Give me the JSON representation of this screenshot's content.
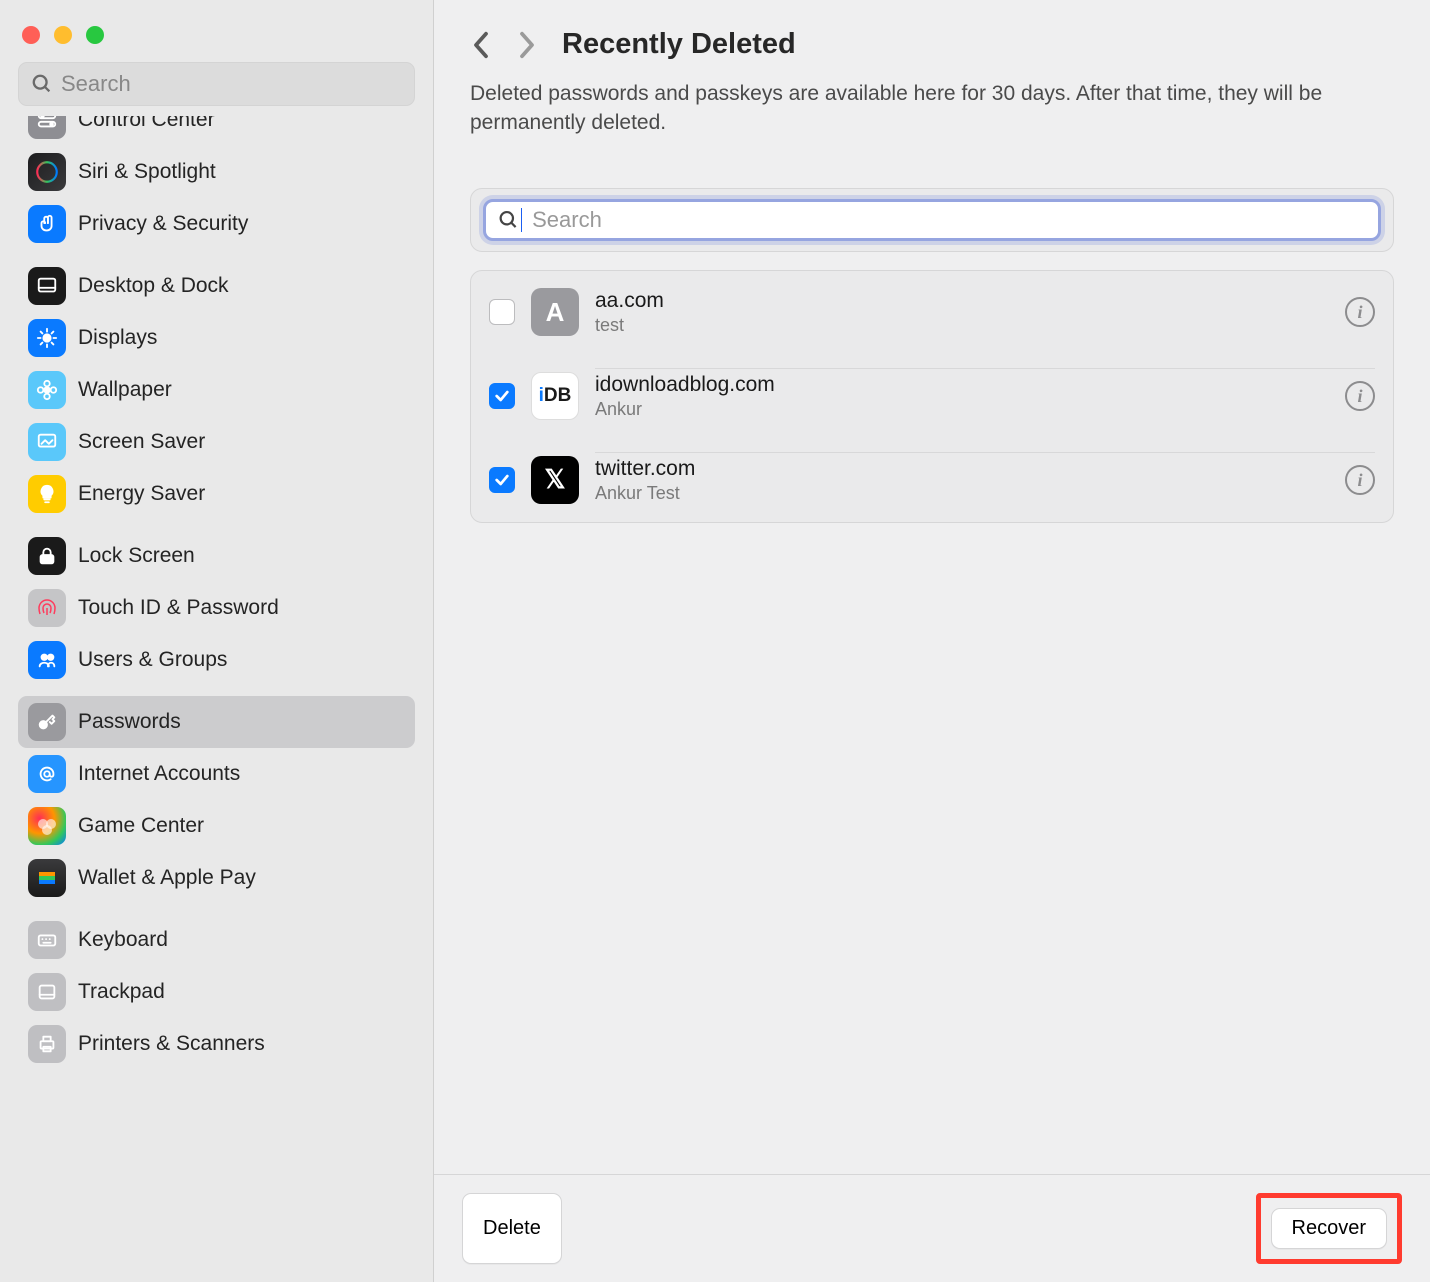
{
  "window": {
    "searchPlaceholder": "Search"
  },
  "sidebar": {
    "groups": [
      {
        "items": [
          {
            "label": "Control Center",
            "iconName": "switches-icon",
            "iconBg": "bg-gray",
            "selected": false,
            "clipped": true
          },
          {
            "label": "Siri & Spotlight",
            "iconName": "siri-icon",
            "iconBg": "bg-siri",
            "selected": false
          },
          {
            "label": "Privacy & Security",
            "iconName": "hand-icon",
            "iconBg": "bg-blue",
            "selected": false
          }
        ]
      },
      {
        "items": [
          {
            "label": "Desktop & Dock",
            "iconName": "dock-icon",
            "iconBg": "bg-black",
            "selected": false
          },
          {
            "label": "Displays",
            "iconName": "brightness-icon",
            "iconBg": "bg-blue",
            "selected": false
          },
          {
            "label": "Wallpaper",
            "iconName": "flower-icon",
            "iconBg": "bg-teal",
            "selected": false
          },
          {
            "label": "Screen Saver",
            "iconName": "screensaver-icon",
            "iconBg": "bg-teal",
            "selected": false
          },
          {
            "label": "Energy Saver",
            "iconName": "bulb-icon",
            "iconBg": "bg-yellow",
            "selected": false
          }
        ]
      },
      {
        "items": [
          {
            "label": "Lock Screen",
            "iconName": "lock-icon",
            "iconBg": "bg-black",
            "selected": false
          },
          {
            "label": "Touch ID & Password",
            "iconName": "fingerprint-icon",
            "iconBg": "bg-ltgray",
            "selected": false
          },
          {
            "label": "Users & Groups",
            "iconName": "users-icon",
            "iconBg": "bg-blue",
            "selected": false
          }
        ]
      },
      {
        "items": [
          {
            "label": "Passwords",
            "iconName": "key-icon",
            "iconBg": "bg-gray2",
            "selected": true
          },
          {
            "label": "Internet Accounts",
            "iconName": "at-icon",
            "iconBg": "bg-atblue",
            "selected": false
          },
          {
            "label": "Game Center",
            "iconName": "gamecenter-icon",
            "iconBg": "bg-rainbow",
            "selected": false
          },
          {
            "label": "Wallet & Apple Pay",
            "iconName": "wallet-icon",
            "iconBg": "bg-wltblack",
            "selected": false
          }
        ]
      },
      {
        "items": [
          {
            "label": "Keyboard",
            "iconName": "keyboard-icon",
            "iconBg": "bg-lgray",
            "selected": false
          },
          {
            "label": "Trackpad",
            "iconName": "trackpad-icon",
            "iconBg": "bg-lgray",
            "selected": false
          },
          {
            "label": "Printers & Scanners",
            "iconName": "printer-icon",
            "iconBg": "bg-lgray",
            "selected": false
          }
        ]
      }
    ]
  },
  "main": {
    "title": "Recently Deleted",
    "description": "Deleted passwords and passkeys are available here for 30 days. After that time, they will be permanently deleted.",
    "searchPlaceholder": "Search",
    "entries": [
      {
        "site": "aa.com",
        "user": "test",
        "checked": false,
        "iconText": "A",
        "iconBg": "bg-a"
      },
      {
        "site": "idownloadblog.com",
        "user": "Ankur",
        "checked": true,
        "iconText": "iDB",
        "iconBg": "bg-idb",
        "iconColor": "#0a7aff"
      },
      {
        "site": "twitter.com",
        "user": "Ankur Test",
        "checked": true,
        "iconText": "𝕏",
        "iconBg": "bg-x"
      }
    ],
    "footer": {
      "delete": "Delete",
      "recover": "Recover"
    }
  }
}
